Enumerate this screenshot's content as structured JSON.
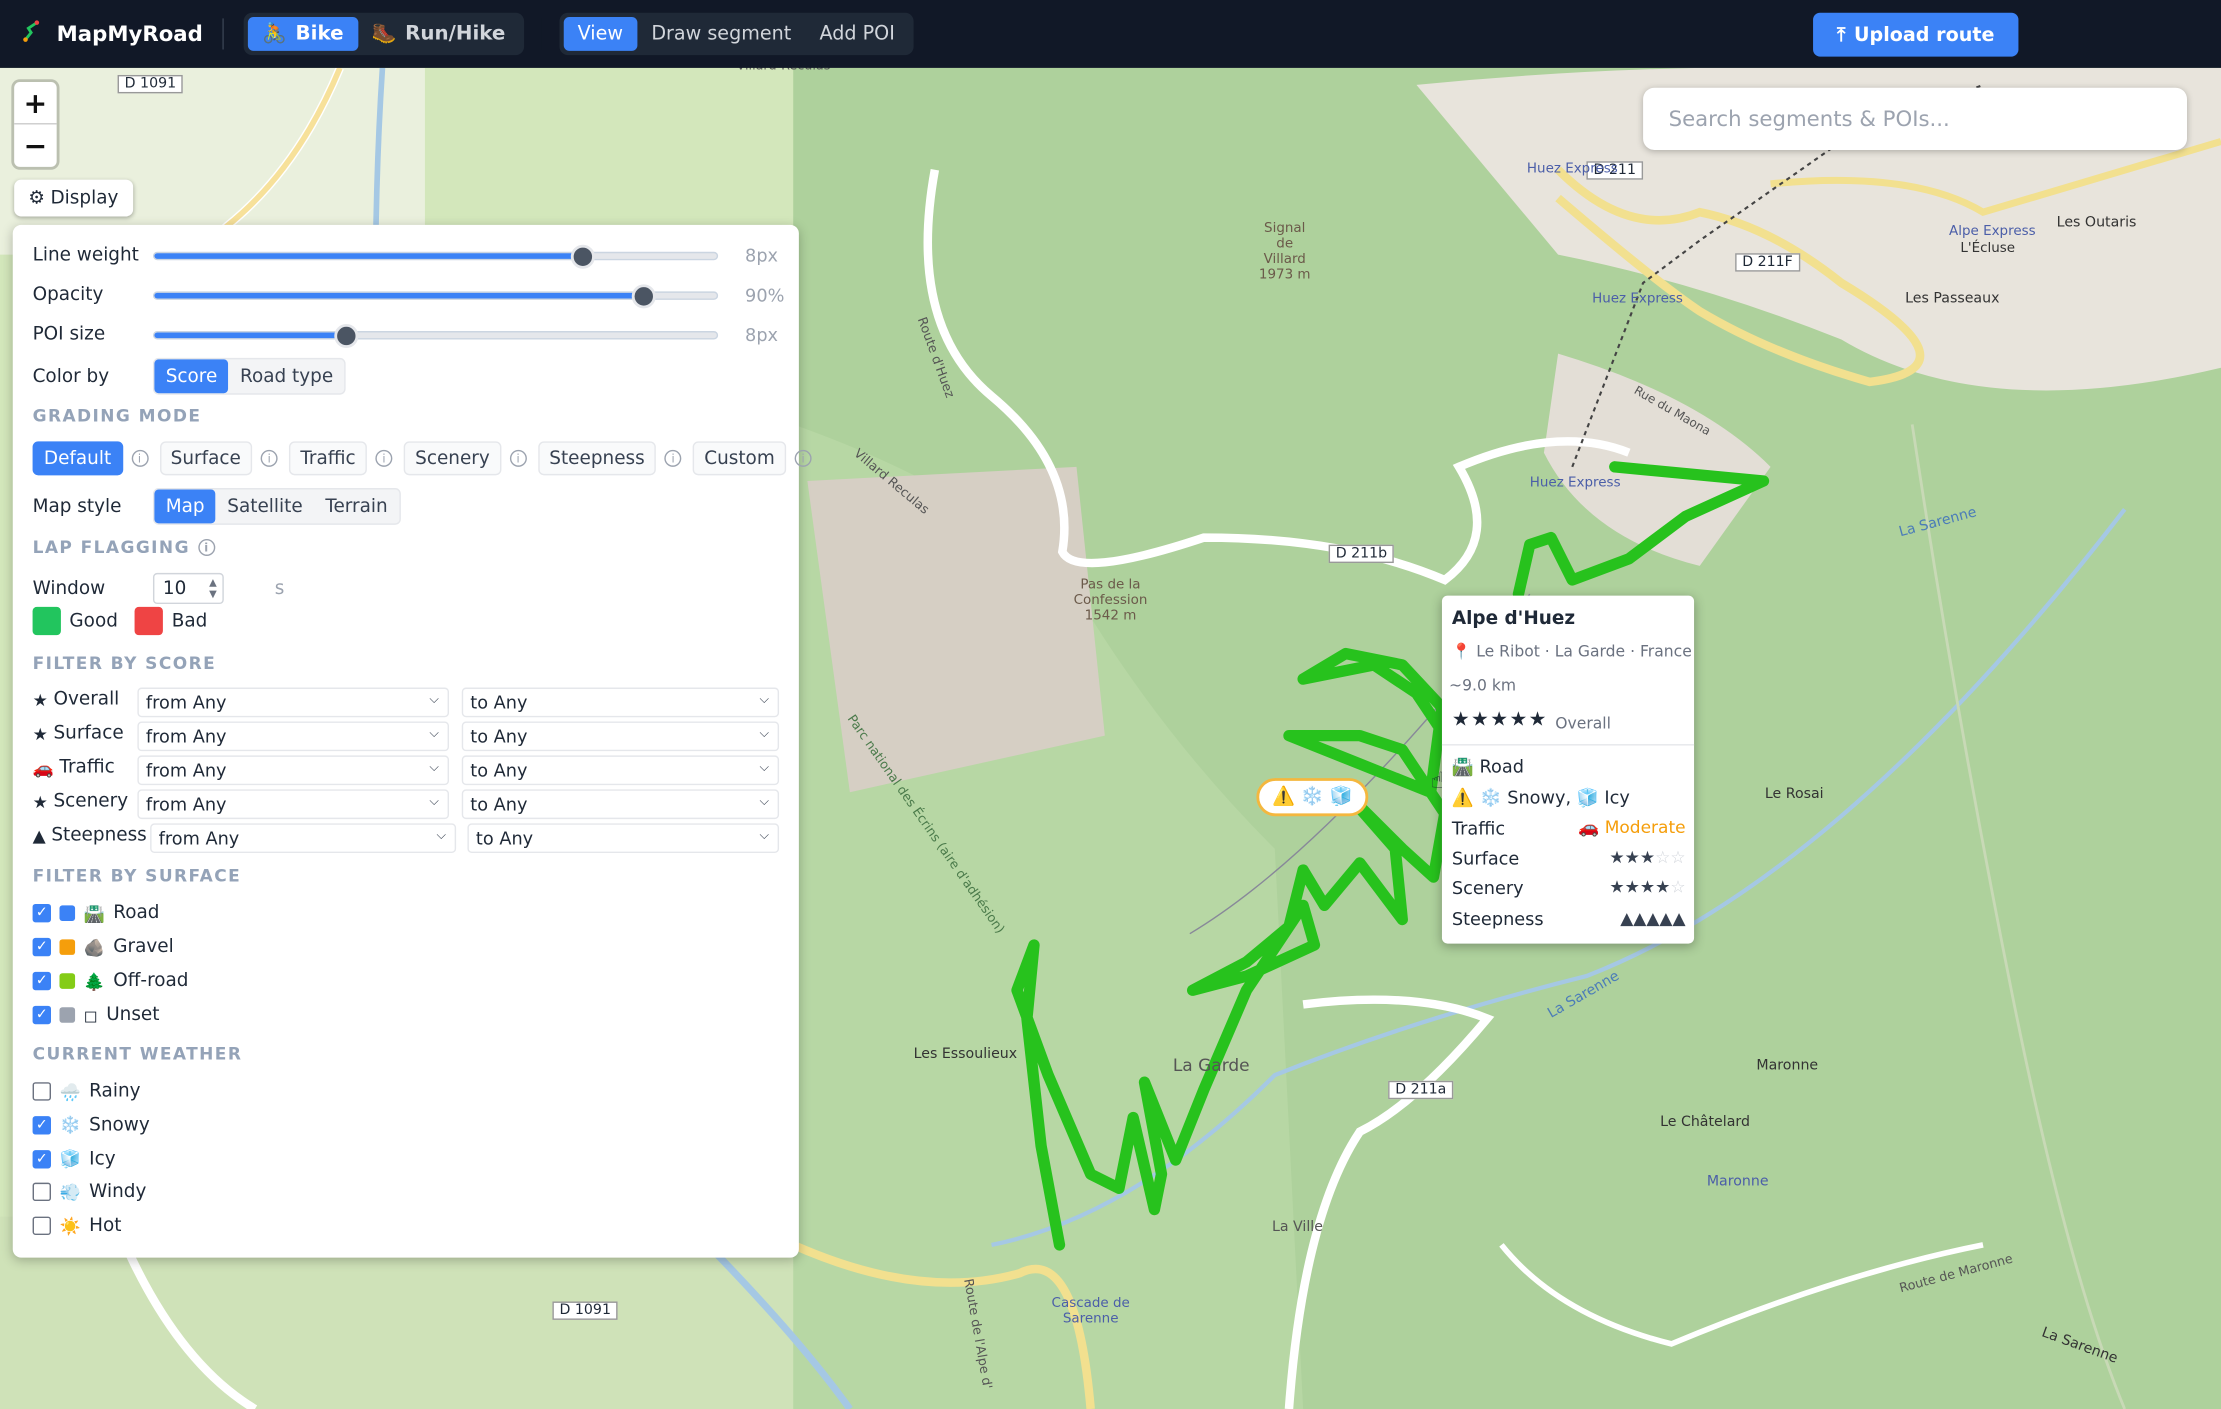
{
  "app": {
    "title": "MapMyRoad"
  },
  "mode": {
    "bike": "Bike",
    "run": "Run/Hike"
  },
  "tools": {
    "view": "View",
    "draw": "Draw segment",
    "add_poi": "Add POI"
  },
  "upload_label": "Upload route",
  "search": {
    "placeholder": "Search segments & POIs..."
  },
  "map": {
    "zoom_in": "+",
    "zoom_out": "−",
    "display_label": "Display",
    "labels": {
      "d1091a": "D 1091",
      "d1091b": "D 1091",
      "d211": "D 211",
      "d211f": "D 211F",
      "d211b": "D 211b",
      "d211a": "D 211a",
      "signal": "Signal de Villard",
      "signal_alt": "1973 m",
      "pas": "Pas de la Confession",
      "pas_alt": "1542 m",
      "huez_express": "Huez Express",
      "huez_express2": "Huez Express",
      "huez_express3": "Huez Express",
      "alpe_express": "Alpe Express",
      "leclose": "L'Écluse",
      "outaris": "Les Outaris",
      "passeaux": "Les Passeaux",
      "rue_maona": "Rue du Maona",
      "essoulieux": "Les Essoulieux",
      "la_garde": "La Garde",
      "la_ville": "La Ville",
      "le_rosai": "Le Rosai",
      "maronne": "Maronne",
      "maronne2": "Maronne",
      "chatelard": "Le Châtelard",
      "cascade": "Cascade de Sarenne",
      "sarenne": "La Sarenne",
      "sarenne2": "La Sarenne",
      "sarenne3": "La Sarenne",
      "route_huez": "Route d'Huez",
      "villard_reculas": "Villard Reculas",
      "parc": "Parc national des Écrins (aire d'adhésion)",
      "route_maronne": "Route de Maronne",
      "villard_top": "Villard-Reculas",
      "route_alpe": "Route de l'Alpe d'"
    }
  },
  "panel": {
    "line_weight": {
      "label": "Line weight",
      "value_text": "8px",
      "fraction": 0.76
    },
    "opacity": {
      "label": "Opacity",
      "value_text": "90%",
      "fraction": 0.87
    },
    "poi_size": {
      "label": "POI size",
      "value_text": "8px",
      "fraction": 0.34
    },
    "color_by": {
      "label": "Color by",
      "options": [
        "Score",
        "Road type"
      ],
      "selected": "Score"
    },
    "grading_mode": {
      "title": "GRADING MODE",
      "options": [
        "Default",
        "Surface",
        "Traffic",
        "Scenery",
        "Steepness",
        "Custom"
      ],
      "selected": "Default"
    },
    "map_style": {
      "label": "Map style",
      "options": [
        "Map",
        "Satellite",
        "Terrain"
      ],
      "selected": "Map"
    },
    "lap_flagging": {
      "title": "LAP FLAGGING",
      "window_label": "Window",
      "window_value": "10",
      "unit": "s",
      "good": "Good",
      "bad": "Bad",
      "good_color": "#22c55e",
      "bad_color": "#ef4444"
    },
    "filter_score": {
      "title": "FILTER BY SCORE",
      "rows": [
        {
          "icon": "★",
          "label": "Overall",
          "from": "from Any",
          "to": "to Any"
        },
        {
          "icon": "★",
          "label": "Surface",
          "from": "from Any",
          "to": "to Any"
        },
        {
          "icon": "🚗",
          "label": "Traffic",
          "from": "from Any",
          "to": "to Any"
        },
        {
          "icon": "★",
          "label": "Scenery",
          "from": "from Any",
          "to": "to Any"
        },
        {
          "icon": "▲",
          "label": "Steepness",
          "from": "from Any",
          "to": "to Any"
        }
      ]
    },
    "filter_surface": {
      "title": "FILTER BY SURFACE",
      "items": [
        {
          "label": "Road",
          "emoji": "🛣️",
          "color": "#3b82f6",
          "checked": true
        },
        {
          "label": "Gravel",
          "emoji": "🪨",
          "color": "#f59e0b",
          "checked": true
        },
        {
          "label": "Off-road",
          "emoji": "🌲",
          "color": "#84cc16",
          "checked": true
        },
        {
          "label": "Unset",
          "emoji": "◻",
          "color": "#9ca3af",
          "checked": true
        }
      ]
    },
    "weather": {
      "title": "CURRENT WEATHER",
      "items": [
        {
          "label": "Rainy",
          "emoji": "🌧️",
          "checked": false
        },
        {
          "label": "Snowy",
          "emoji": "❄️",
          "checked": true
        },
        {
          "label": "Icy",
          "emoji": "🧊",
          "checked": true
        },
        {
          "label": "Windy",
          "emoji": "💨",
          "checked": false
        },
        {
          "label": "Hot",
          "emoji": "☀️",
          "checked": false
        }
      ]
    }
  },
  "tooltip": {
    "title": "Alpe d'Huez",
    "location": "📍 Le Ribot · La Garde · France",
    "distance": "~9.0 km",
    "stars": "★★★★★",
    "overall_label": "Overall",
    "surface_type": "🛣️ Road",
    "weather": "⚠️ ❄️ Snowy, 🧊 Icy",
    "traffic_label": "Traffic",
    "traffic_value": "🚗 Moderate",
    "surface_label": "Surface",
    "surface_stars": 3,
    "scenery_label": "Scenery",
    "scenery_stars": 4,
    "steepness_label": "Steepness",
    "steepness_value": "▲▲▲▲▲"
  },
  "badge": {
    "icons": "⚠️ ❄️ 🧊"
  },
  "colors": {
    "accent": "#3b82f6",
    "route": "#22c55e",
    "topbar": "#111827"
  }
}
